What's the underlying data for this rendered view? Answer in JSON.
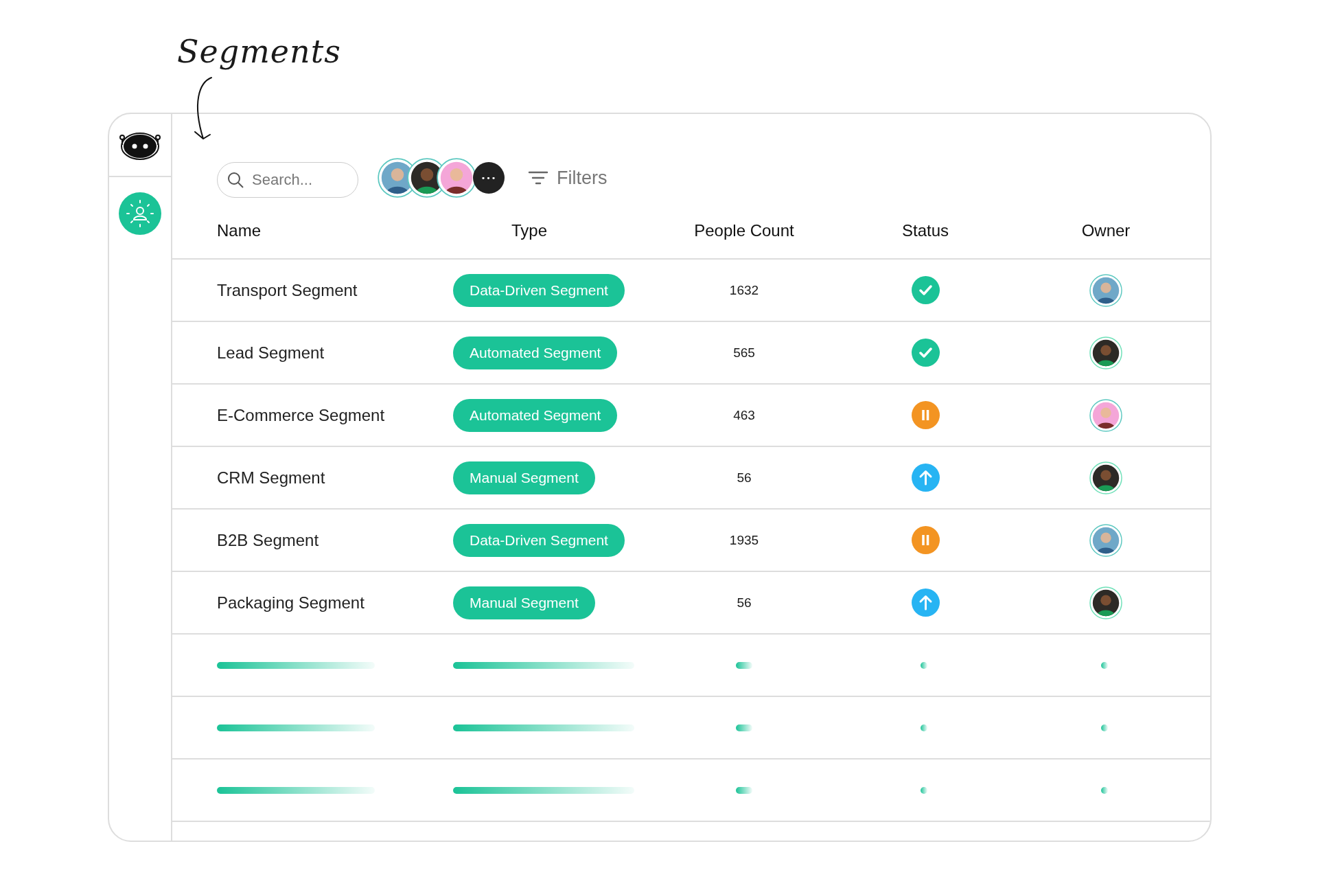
{
  "annotation": {
    "title": "Segments"
  },
  "toolbar": {
    "search": {
      "placeholder": "Search..."
    },
    "avatars_more": "•••",
    "filters": "Filters"
  },
  "table": {
    "columns": [
      "Name",
      "Type",
      "People Count",
      "Status",
      "Owner"
    ],
    "rows": [
      {
        "kind": "segment",
        "name": "Transport Segment",
        "type": "Data-Driven Segment",
        "people_count": "1632",
        "status": {
          "kind": "done"
        }
      },
      {
        "kind": "segment",
        "name": "Lead Segment",
        "type": "Automated Segment",
        "people_count": "565",
        "status": {
          "kind": "done"
        }
      },
      {
        "kind": "segment",
        "name": "E-Commerce Segment",
        "type": "Automated Segment",
        "people_count": "463",
        "status": {
          "kind": "paused"
        }
      },
      {
        "kind": "segment",
        "name": "CRM Segment",
        "type": "Manual Segment",
        "people_count": "56",
        "status": {
          "kind": "rising"
        }
      },
      {
        "kind": "segment",
        "name": "B2B Segment",
        "type": "Data-Driven Segment",
        "people_count": "1935",
        "status": {
          "kind": "paused"
        }
      },
      {
        "kind": "segment",
        "name": "Packaging Segment",
        "type": "Manual Segment",
        "people_count": "56",
        "status": {
          "kind": "rising"
        }
      },
      {
        "kind": "loading"
      },
      {
        "kind": "loading"
      },
      {
        "kind": "loading"
      }
    ]
  }
}
